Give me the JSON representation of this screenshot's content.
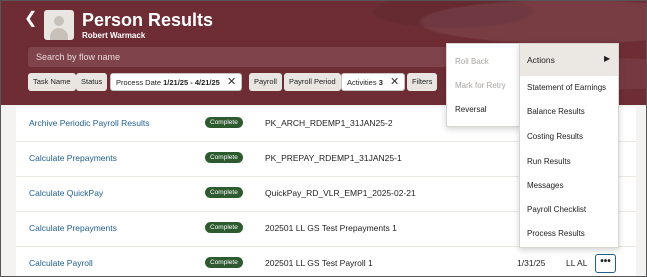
{
  "header": {
    "back_icon": "chevron-left-icon",
    "title": "Person Results",
    "subtitle": "Robert Warmack",
    "search_placeholder": "Search by flow name"
  },
  "filters": [
    {
      "label": "Task Name"
    },
    {
      "label": "Status"
    },
    {
      "label": "Process Date",
      "value": "1/21/25 - 4/21/25",
      "active": true
    },
    {
      "label": "Payroll"
    },
    {
      "label": "Payroll Period"
    },
    {
      "label": "Activities",
      "value": "3",
      "active": true
    },
    {
      "label": "Filters"
    }
  ],
  "rows": [
    {
      "name": "Archive Periodic Payroll Results",
      "status": "Complete",
      "flow": "PK_ARCH_RDEMP1_31JAN25-2"
    },
    {
      "name": "Calculate Prepayments",
      "status": "Complete",
      "flow": "PK_PREPAY_RDEMP1_31JAN25-1"
    },
    {
      "name": "Calculate QuickPay",
      "status": "Complete",
      "flow": "QuickPay_RD_VLR_EMP1_2025-02-21"
    },
    {
      "name": "Calculate Prepayments",
      "status": "Complete",
      "flow": "202501 LL GS Test Prepayments 1"
    },
    {
      "name": "Calculate Payroll",
      "status": "Complete",
      "flow": "202501 LL GS Test Payroll 1",
      "date": "1/31/25",
      "user": "LL AL"
    }
  ],
  "submenu": {
    "items": [
      {
        "label": "Roll Back",
        "disabled": true
      },
      {
        "label": "Mark for Retry",
        "disabled": true
      },
      {
        "label": "Reversal",
        "disabled": false
      }
    ]
  },
  "actions_menu": {
    "header": "Actions",
    "items": [
      "Statement of Earnings",
      "Balance Results",
      "Costing Results",
      "Run Results",
      "Messages",
      "Payroll Checklist",
      "Process Results"
    ]
  },
  "more_button": "•••"
}
